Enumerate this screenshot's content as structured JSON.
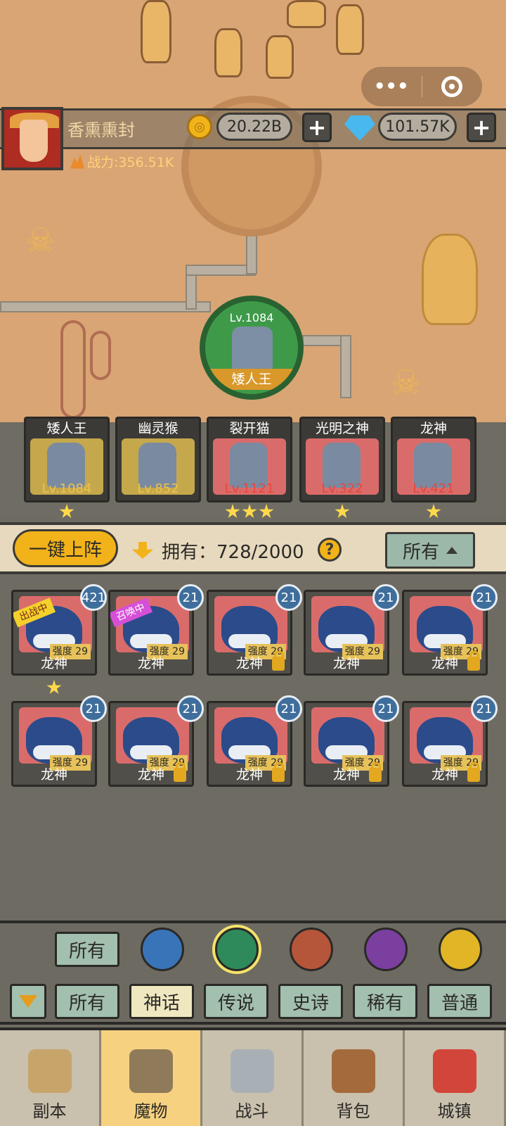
{
  "capsule": {
    "more_icon": "more-dots-icon",
    "close_icon": "target-ring-icon"
  },
  "player": {
    "name": "香熏熏封",
    "power": "战力:356.51K",
    "gold": "20.22B",
    "gems": "101.57K"
  },
  "map_node": {
    "level": "Lv.1084",
    "name": "矮人王"
  },
  "team": [
    {
      "name": "矮人王",
      "level": "Lv.1084",
      "stars": 1,
      "bg": "#c5a84c",
      "lv_color": "#f0c14c"
    },
    {
      "name": "幽灵猴",
      "level": "Lv.852",
      "stars": 0,
      "bg": "#c5a84c",
      "lv_color": "#f0c14c"
    },
    {
      "name": "裂开猫",
      "level": "Lv.1121",
      "stars": 3,
      "bg": "#d96c6b",
      "lv_color": "#e5473d"
    },
    {
      "name": "光明之神",
      "level": "Lv.322",
      "stars": 1,
      "bg": "#d96c6b",
      "lv_color": "#e5473d"
    },
    {
      "name": "龙神",
      "level": "Lv.421",
      "stars": 1,
      "bg": "#d96c6b",
      "lv_color": "#e5473d"
    }
  ],
  "toolbar": {
    "deploy_label": "一键上阵",
    "owned_label": "拥有：728/2000",
    "help_label": "?",
    "filter_label": "所有"
  },
  "monsters": [
    {
      "name": "龙神",
      "level": "421",
      "strength": "强度 29",
      "tag": "出战中",
      "locked": false,
      "star": true
    },
    {
      "name": "龙神",
      "level": "21",
      "strength": "强度 29",
      "tag": "召唤中",
      "locked": false,
      "star": false
    },
    {
      "name": "龙神",
      "level": "21",
      "strength": "强度 29",
      "tag": "",
      "locked": true,
      "star": false
    },
    {
      "name": "龙神",
      "level": "21",
      "strength": "强度 29",
      "tag": "",
      "locked": false,
      "star": false
    },
    {
      "name": "龙神",
      "level": "21",
      "strength": "强度 29",
      "tag": "",
      "locked": true,
      "star": false
    },
    {
      "name": "龙神",
      "level": "21",
      "strength": "强度 29",
      "tag": "",
      "locked": false,
      "star": false
    },
    {
      "name": "龙神",
      "level": "21",
      "strength": "强度 29",
      "tag": "",
      "locked": true,
      "star": false
    },
    {
      "name": "龙神",
      "level": "21",
      "strength": "强度 29",
      "tag": "",
      "locked": true,
      "star": false
    },
    {
      "name": "龙神",
      "level": "21",
      "strength": "强度 29",
      "tag": "",
      "locked": true,
      "star": false
    },
    {
      "name": "龙神",
      "level": "21",
      "strength": "强度 29",
      "tag": "",
      "locked": true,
      "star": false
    }
  ],
  "filters": {
    "faction_all": "所有",
    "factions": [
      {
        "icon": "blue-faction-icon",
        "color": "#3a74b8"
      },
      {
        "icon": "green-faction-icon",
        "color": "#2f8a5b"
      },
      {
        "icon": "red-faction-icon",
        "color": "#b5553a"
      },
      {
        "icon": "purple-faction-icon",
        "color": "#7b3fa0"
      },
      {
        "icon": "gold-faction-icon",
        "color": "#e1b526"
      }
    ],
    "rarity": [
      "所有",
      "神话",
      "传说",
      "史诗",
      "稀有",
      "普通"
    ],
    "rarity_active": 1
  },
  "nav": [
    {
      "label": "副本",
      "icon": "map-scroll-icon",
      "color": "#c7a46a"
    },
    {
      "label": "魔物",
      "icon": "monster-helmet-icon",
      "color": "#8f7a5a"
    },
    {
      "label": "战斗",
      "icon": "crossed-swords-icon",
      "color": "#a9b0b5"
    },
    {
      "label": "背包",
      "icon": "backpack-icon",
      "color": "#a56a3c"
    },
    {
      "label": "城镇",
      "icon": "shop-awning-icon",
      "color": "#d2453a"
    }
  ],
  "nav_active": 1
}
